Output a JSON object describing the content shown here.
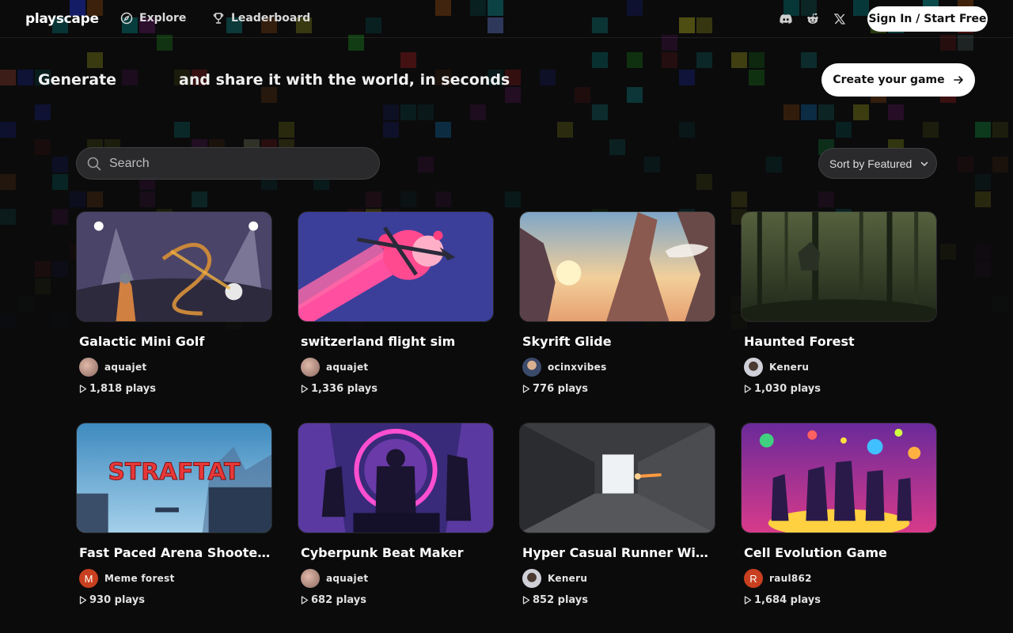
{
  "nav": {
    "logo": "playscape",
    "explore": "Explore",
    "leaderboard": "Leaderboard",
    "icons": [
      "discord-icon",
      "reddit-icon",
      "x-icon"
    ],
    "signin": "Sign In / Start Free"
  },
  "hero": {
    "prefix": "Generate",
    "suffix": "and share it with the world, in seconds",
    "cta": "Create your game"
  },
  "search": {
    "placeholder": "Search"
  },
  "sort": {
    "label": "Sort by Featured"
  },
  "games": [
    {
      "title": "Galactic Mini Golf",
      "author": "aquajet",
      "avatar": "",
      "plays": "1,818 plays"
    },
    {
      "title": "switzerland flight sim",
      "author": "aquajet",
      "avatar": "",
      "plays": "1,336 plays"
    },
    {
      "title": "Skyrift Glide",
      "author": "ocinxvibes",
      "avatar": "",
      "plays": "776 plays"
    },
    {
      "title": "Haunted Forest",
      "author": "Keneru",
      "avatar": "",
      "plays": "1,030 plays"
    },
    {
      "title": "Fast Paced Arena Shooter Sk...",
      "author": "Meme forest",
      "avatar": "M",
      "plays": "930 plays"
    },
    {
      "title": "Cyberpunk Beat Maker",
      "author": "aquajet",
      "avatar": "",
      "plays": "682 plays"
    },
    {
      "title": "Hyper Casual Runner With G...",
      "author": "Keneru",
      "avatar": "",
      "plays": "852 plays"
    },
    {
      "title": "Cell Evolution Game",
      "author": "raul862",
      "avatar": "R",
      "plays": "1,684 plays"
    }
  ],
  "thumb_texts": {
    "straftat": "STRAFTAT"
  },
  "colors": {
    "accent": "#ffffff",
    "background": "#0b0b0c",
    "surface": "#2a2a2c"
  }
}
